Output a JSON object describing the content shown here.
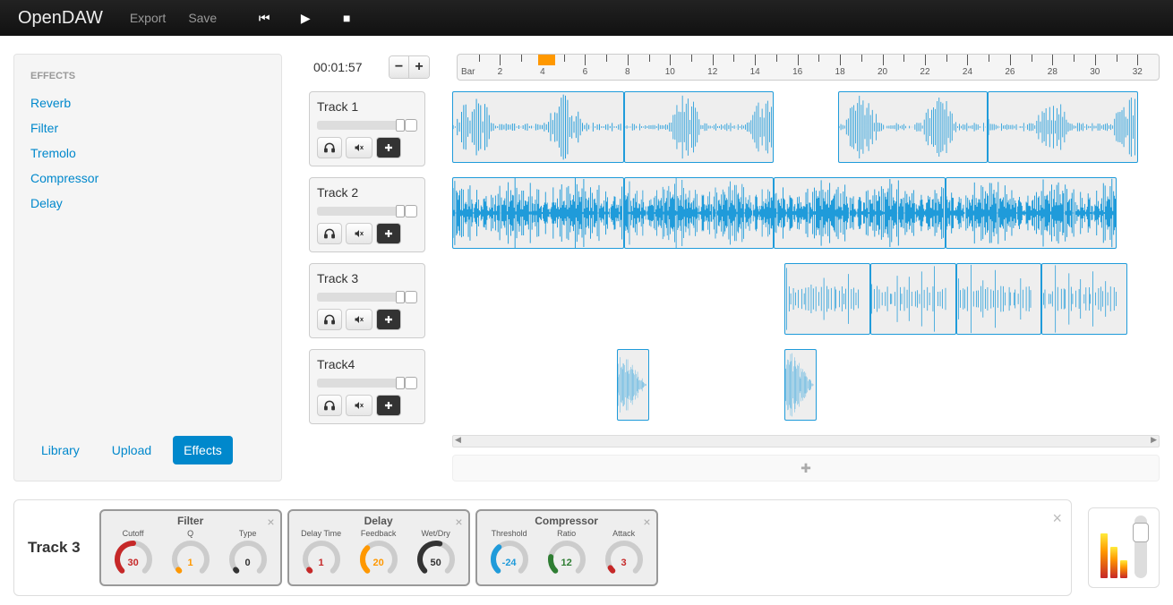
{
  "app": {
    "name": "OpenDAW"
  },
  "nav": {
    "export": "Export",
    "save": "Save"
  },
  "transport": {
    "time": "00:01:57"
  },
  "sidebar": {
    "heading": "Effects",
    "effects": [
      "Reverb",
      "Filter",
      "Tremolo",
      "Compressor",
      "Delay"
    ],
    "tabs": {
      "library": "Library",
      "upload": "Upload",
      "effects": "Effects"
    }
  },
  "timeline": {
    "bar_label": "Bar",
    "bars": [
      2,
      4,
      6,
      8,
      10,
      12,
      14,
      16,
      18,
      20,
      22,
      24,
      26,
      28,
      30,
      32
    ],
    "marker_start": 3.8,
    "marker_end": 4.6
  },
  "tracks": [
    {
      "name": "Track 1",
      "clips": [
        {
          "start": 0,
          "len": 8
        },
        {
          "start": 8,
          "len": 7
        },
        {
          "start": 18,
          "len": 7
        },
        {
          "start": 25,
          "len": 7
        }
      ]
    },
    {
      "name": "Track 2",
      "clips": [
        {
          "start": 0,
          "len": 8
        },
        {
          "start": 8,
          "len": 7
        },
        {
          "start": 15,
          "len": 8
        },
        {
          "start": 23,
          "len": 8
        }
      ]
    },
    {
      "name": "Track 3",
      "clips": [
        {
          "start": 15.5,
          "len": 4
        },
        {
          "start": 19.5,
          "len": 4
        },
        {
          "start": 23.5,
          "len": 4
        },
        {
          "start": 27.5,
          "len": 4
        }
      ]
    },
    {
      "name": "Track4",
      "clips": [
        {
          "start": 7.7,
          "len": 1.5
        },
        {
          "start": 15.5,
          "len": 1.5
        }
      ]
    }
  ],
  "fx_panel": {
    "track": "Track 3",
    "effects": [
      {
        "name": "Filter",
        "params": [
          {
            "label": "Cutoff",
            "value": "30",
            "color": "#c62828"
          },
          {
            "label": "Q",
            "value": "1",
            "color": "#ff9800"
          },
          {
            "label": "Type",
            "value": "0",
            "color": "#333"
          }
        ]
      },
      {
        "name": "Delay",
        "params": [
          {
            "label": "Delay Time",
            "value": "1",
            "color": "#c62828"
          },
          {
            "label": "Feedback",
            "value": "20",
            "color": "#ff9800"
          },
          {
            "label": "Wet/Dry",
            "value": "50",
            "color": "#333"
          }
        ]
      },
      {
        "name": "Compressor",
        "params": [
          {
            "label": "Threshold",
            "value": "-24",
            "color": "#1f9bda"
          },
          {
            "label": "Ratio",
            "value": "12",
            "color": "#2e7d32"
          },
          {
            "label": "Attack",
            "value": "3",
            "color": "#c62828"
          }
        ]
      }
    ]
  },
  "master": {
    "meters": [
      50,
      35,
      20
    ],
    "slider": 8
  }
}
